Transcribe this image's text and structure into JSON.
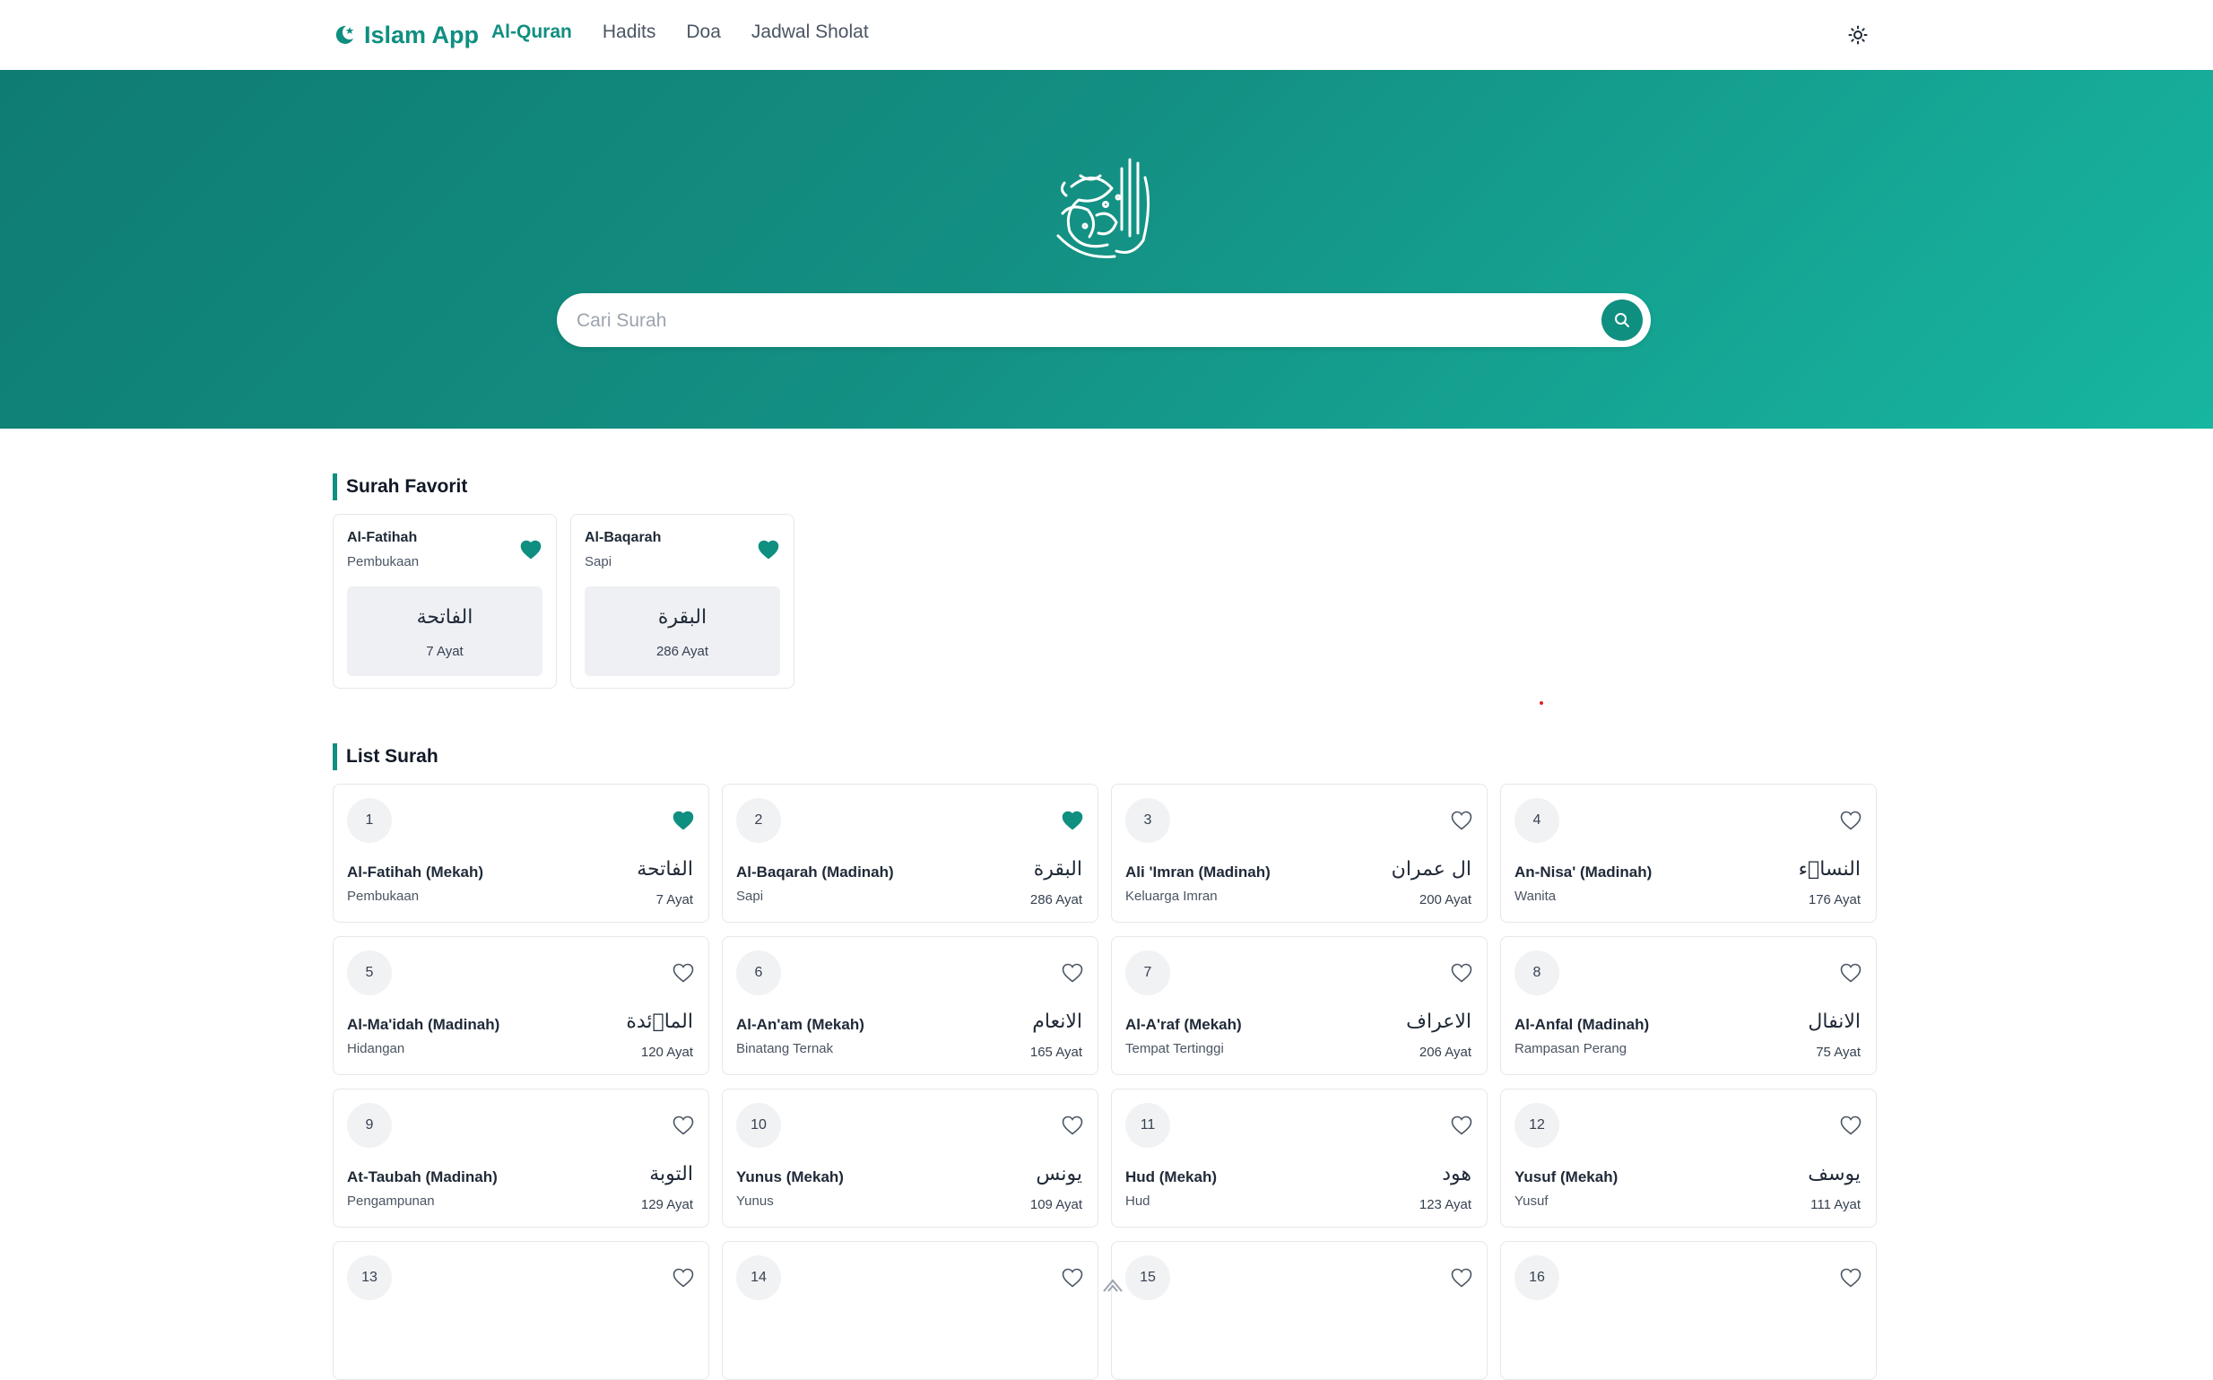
{
  "brand": {
    "name": "Islam App"
  },
  "nav": {
    "links": [
      "Al-Quran",
      "Hadits",
      "Doa",
      "Jadwal Sholat"
    ],
    "active": "Al-Quran"
  },
  "search": {
    "placeholder": "Cari Surah",
    "value": ""
  },
  "colors": {
    "accent": "#0f8f80",
    "hero_start": "#0f7c72",
    "hero_end": "#17b6a1",
    "card_border": "#e5e7eb"
  },
  "favorites": {
    "title": "Surah Favorit",
    "items": [
      {
        "name": "Al-Fatihah",
        "meaning": "Pembukaan",
        "arabic": "الفاتحة",
        "ayat": "7 Ayat",
        "favorited": true
      },
      {
        "name": "Al-Baqarah",
        "meaning": "Sapi",
        "arabic": "البقرة",
        "ayat": "286 Ayat",
        "favorited": true
      }
    ]
  },
  "list": {
    "title": "List Surah",
    "items": [
      {
        "number": "1",
        "name": "Al-Fatihah (Mekah)",
        "meaning": "Pembukaan",
        "arabic": "الفاتحة",
        "ayat": "7 Ayat",
        "favorited": true
      },
      {
        "number": "2",
        "name": "Al-Baqarah (Madinah)",
        "meaning": "Sapi",
        "arabic": "البقرة",
        "ayat": "286 Ayat",
        "favorited": true
      },
      {
        "number": "3",
        "name": "Ali 'Imran (Madinah)",
        "meaning": "Keluarga Imran",
        "arabic": "ال عمران",
        "ayat": "200 Ayat",
        "favorited": false
      },
      {
        "number": "4",
        "name": "An-Nisa' (Madinah)",
        "meaning": "Wanita",
        "arabic": "النساۤء",
        "ayat": "176 Ayat",
        "favorited": false
      },
      {
        "number": "5",
        "name": "Al-Ma'idah (Madinah)",
        "meaning": "Hidangan",
        "arabic": "الماۤئدة",
        "ayat": "120 Ayat",
        "favorited": false
      },
      {
        "number": "6",
        "name": "Al-An'am (Mekah)",
        "meaning": "Binatang Ternak",
        "arabic": "الانعام",
        "ayat": "165 Ayat",
        "favorited": false
      },
      {
        "number": "7",
        "name": "Al-A'raf (Mekah)",
        "meaning": "Tempat Tertinggi",
        "arabic": "الاعراف",
        "ayat": "206 Ayat",
        "favorited": false
      },
      {
        "number": "8",
        "name": "Al-Anfal (Madinah)",
        "meaning": "Rampasan Perang",
        "arabic": "الانفال",
        "ayat": "75 Ayat",
        "favorited": false
      },
      {
        "number": "9",
        "name": "At-Taubah (Madinah)",
        "meaning": "Pengampunan",
        "arabic": "التوبة",
        "ayat": "129 Ayat",
        "favorited": false
      },
      {
        "number": "10",
        "name": "Yunus (Mekah)",
        "meaning": "Yunus",
        "arabic": "يونس",
        "ayat": "109 Ayat",
        "favorited": false
      },
      {
        "number": "11",
        "name": "Hud (Mekah)",
        "meaning": "Hud",
        "arabic": "هود",
        "ayat": "123 Ayat",
        "favorited": false
      },
      {
        "number": "12",
        "name": "Yusuf (Mekah)",
        "meaning": "Yusuf",
        "arabic": "يوسف",
        "ayat": "111 Ayat",
        "favorited": false
      },
      {
        "number": "13",
        "favorited": false
      },
      {
        "number": "14",
        "favorited": false
      },
      {
        "number": "15",
        "favorited": false
      },
      {
        "number": "16",
        "favorited": false
      }
    ]
  }
}
